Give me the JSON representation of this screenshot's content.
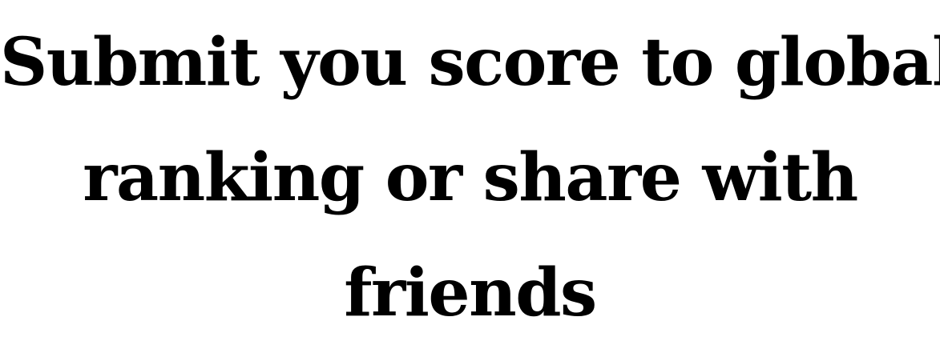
{
  "heading": {
    "line_1": "Submit you score to global",
    "line_2": "ranking or share with",
    "line_3": "friends"
  },
  "colors": {
    "background": "#ffffff",
    "text": "#000000"
  }
}
